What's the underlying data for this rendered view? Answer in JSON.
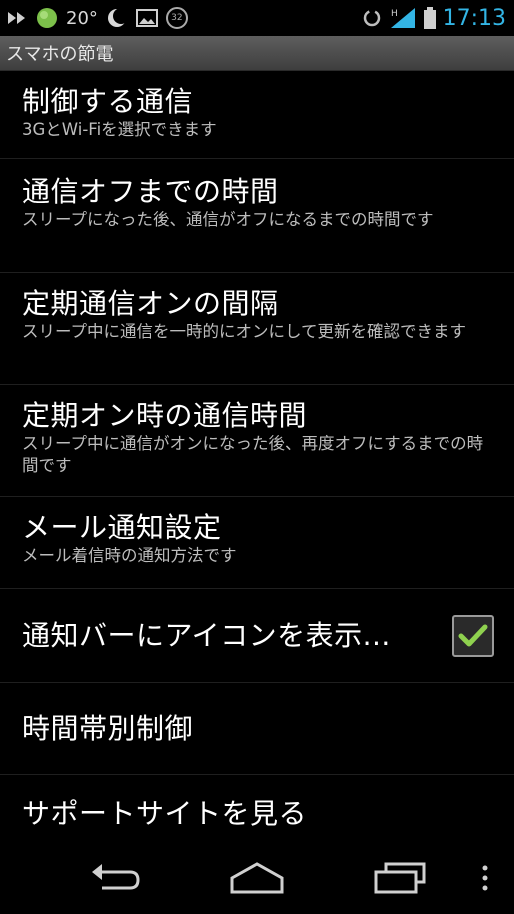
{
  "status_bar": {
    "icons_left": [
      "fast-forward-icon",
      "green-ball-icon",
      "weather-icon",
      "moon-icon",
      "picture-icon",
      "counter-badge-icon"
    ],
    "temperature": "20°",
    "badge_count": "32",
    "icons_right": [
      "sync-icon",
      "signal-icon",
      "battery-icon"
    ],
    "time": "17:13",
    "accent_color": "#33b5e5"
  },
  "title_bar": {
    "title": "スマホの節電"
  },
  "settings": [
    {
      "title": "制御する通信",
      "subtitle": "3GとWi-Fiを選択できます"
    },
    {
      "title": "通信オフまでの時間",
      "subtitle": "スリープになった後、通信がオフになるまでの時間です"
    },
    {
      "title": "定期通信オンの間隔",
      "subtitle": "スリープ中に通信を一時的にオンにして更新を確認できます"
    },
    {
      "title": "定期オン時の通信時間",
      "subtitle": "スリープ中に通信がオンになった後、再度オフにするまでの時間です"
    },
    {
      "title": "メール通知設定",
      "subtitle": "メール着信時の通知方法です"
    },
    {
      "title": "通知バーにアイコンを表示...",
      "checked": true
    },
    {
      "title": "時間帯別制御"
    },
    {
      "title": "サポートサイトを見る"
    }
  ],
  "navigation_bar": {
    "buttons": [
      "back-icon",
      "home-icon",
      "recent-apps-icon",
      "overflow-menu-icon"
    ]
  }
}
